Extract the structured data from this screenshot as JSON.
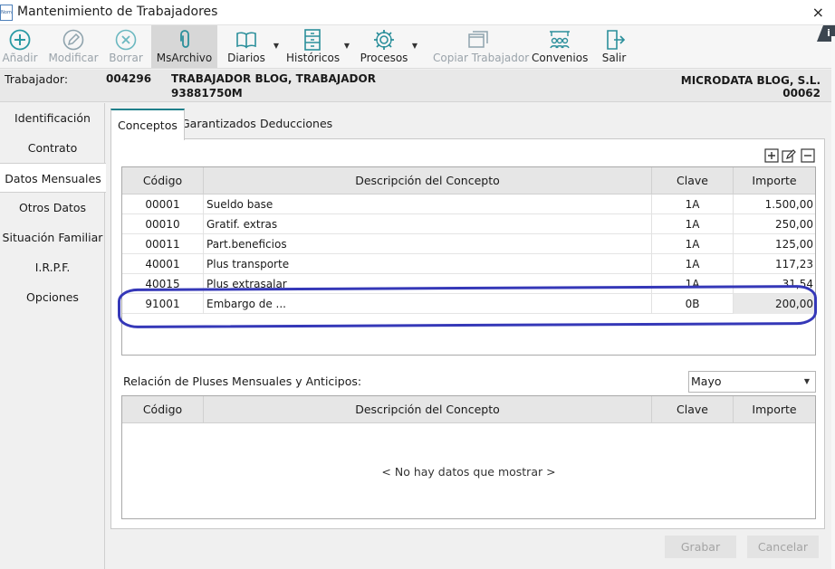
{
  "window": {
    "title": "Mantenimiento de Trabajadores",
    "app_icon_text": "Nom",
    "close_glyph": "×"
  },
  "colors": {
    "accent": "#1f7f8a",
    "highlight_stroke": "#3538b8",
    "disabled_text": "#9aa3aa"
  },
  "toolbar": {
    "anadir": "Añadir",
    "modificar": "Modificar",
    "borrar": "Borrar",
    "msarchivo": "MsArchivo",
    "diarios": "Diarios",
    "historicos": "Históricos",
    "procesos": "Procesos",
    "copiar": "Copiar Trabajador",
    "convenios": "Convenios",
    "salir": "Salir",
    "info_badge": "i"
  },
  "worker": {
    "label": "Trabajador:",
    "code": "004296",
    "name": "TRABAJADOR BLOG, TRABAJADOR",
    "nif": "93881750M",
    "company": "MICRODATA BLOG, S.L.",
    "company_code": "00062"
  },
  "nav": {
    "items": [
      "Identificación",
      "Contrato",
      "Datos Mensuales",
      "Otros Datos",
      "Situación Familiar",
      "I.R.P.F.",
      "Opciones"
    ]
  },
  "tabs": [
    "Conceptos",
    "Garantizados",
    "Deducciones"
  ],
  "grid": {
    "headers": [
      "Código",
      "Descripción del Concepto",
      "Clave",
      "Importe"
    ],
    "rows": [
      {
        "codigo": "00001",
        "descripcion": "Sueldo base",
        "clave": "1A",
        "importe": "1.500,00"
      },
      {
        "codigo": "00010",
        "descripcion": "Gratif. extras",
        "clave": "1A",
        "importe": "250,00"
      },
      {
        "codigo": "00011",
        "descripcion": "Part.beneficios",
        "clave": "1A",
        "importe": "125,00"
      },
      {
        "codigo": "40001",
        "descripcion": "Plus transporte",
        "clave": "1A",
        "importe": "117,23"
      },
      {
        "codigo": "40015",
        "descripcion": "Plus extrasalar",
        "clave": "1A",
        "importe": "31,54"
      },
      {
        "codigo": "91001",
        "descripcion": "Embargo de ...",
        "clave": "0B",
        "importe": "200,00"
      }
    ]
  },
  "pluses": {
    "label": "Relación de Pluses Mensuales y Anticipos:",
    "month": "Mayo",
    "headers": [
      "Código",
      "Descripción del Concepto",
      "Clave",
      "Importe"
    ],
    "empty": "< No hay datos que mostrar >"
  },
  "buttons": {
    "grabar": "Grabar",
    "cancelar": "Cancelar"
  }
}
